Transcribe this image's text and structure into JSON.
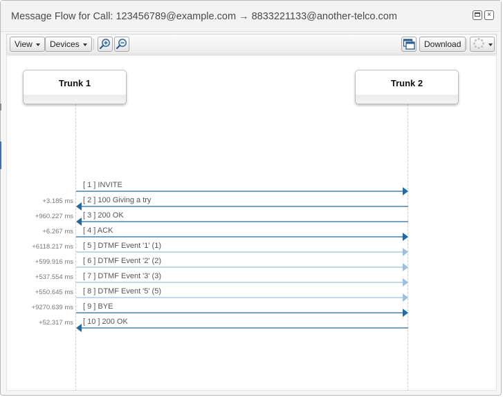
{
  "window": {
    "title": "Message Flow for Call: 123456789@example.com → 8833221133@another-telco.com"
  },
  "toolbar": {
    "view_label": "View",
    "devices_label": "Devices",
    "download_label": "Download",
    "icons": [
      "zoom-in-icon",
      "zoom-out-icon",
      "windows-icon",
      "settings-spinner-icon"
    ]
  },
  "devices": [
    {
      "label": "Trunk 1"
    },
    {
      "label": "Trunk 2"
    }
  ],
  "colors": {
    "primary_arrow": "#1f6aa5",
    "secondary_arrow": "#9dbfe0",
    "lifeline": "#d0d0d0"
  },
  "messages": [
    {
      "label": "[ 1 ] INVITE",
      "delta": "",
      "from": 0,
      "to": 1,
      "style": "primary"
    },
    {
      "label": "[ 2 ] 100 Giving a try",
      "delta": "+3.185 ms",
      "from": 1,
      "to": 0,
      "style": "primary"
    },
    {
      "label": "[ 3 ] 200 OK",
      "delta": "+960.227 ms",
      "from": 1,
      "to": 0,
      "style": "primary"
    },
    {
      "label": "[ 4 ] ACK",
      "delta": "+6.267 ms",
      "from": 0,
      "to": 1,
      "style": "primary"
    },
    {
      "label": "[ 5 ] DTMF Event '1' (1)",
      "delta": "+6118.217 ms",
      "from": 0,
      "to": 1,
      "style": "secondary"
    },
    {
      "label": "[ 6 ] DTMF Event '2' (2)",
      "delta": "+599.916 ms",
      "from": 0,
      "to": 1,
      "style": "secondary"
    },
    {
      "label": "[ 7 ] DTMF Event '3' (3)",
      "delta": "+537.554 ms",
      "from": 0,
      "to": 1,
      "style": "secondary"
    },
    {
      "label": "[ 8 ] DTMF Event '5' (5)",
      "delta": "+550.645 ms",
      "from": 0,
      "to": 1,
      "style": "secondary"
    },
    {
      "label": "[ 9 ] BYE",
      "delta": "+9270.639 ms",
      "from": 0,
      "to": 1,
      "style": "primary"
    },
    {
      "label": "[ 10 ] 200 OK",
      "delta": "+52.317 ms",
      "from": 1,
      "to": 0,
      "style": "primary"
    }
  ]
}
